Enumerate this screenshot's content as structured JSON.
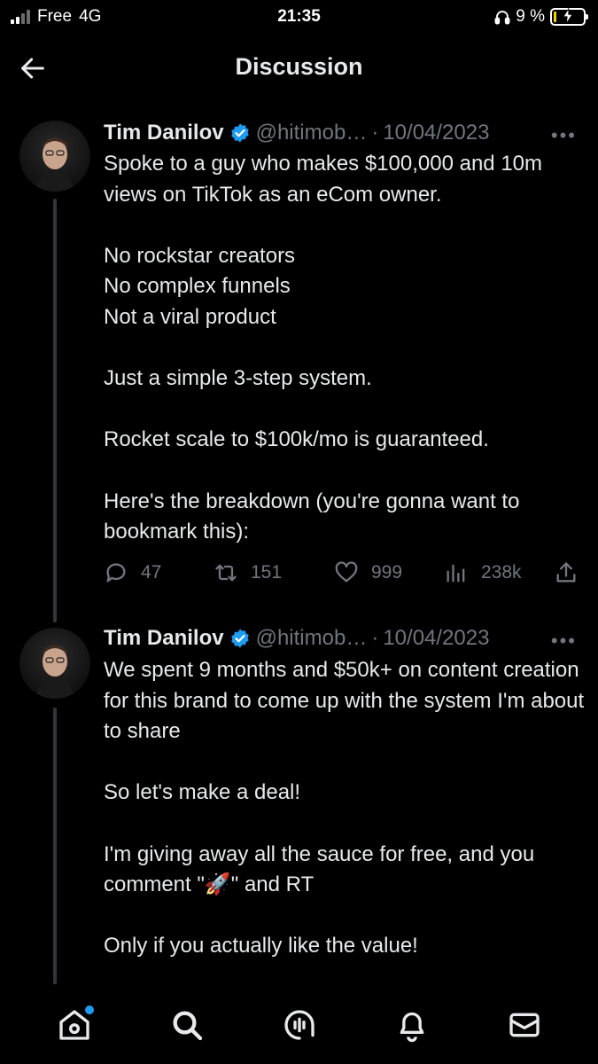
{
  "status_bar": {
    "carrier": "Free",
    "network": "4G",
    "time": "21:35",
    "battery_percent": "9 %",
    "battery_level": 0.09
  },
  "header": {
    "title": "Discussion",
    "back_icon": "arrow-left-icon"
  },
  "tweets": [
    {
      "author_name": "Tim Danilov",
      "handle": "@hitimob…",
      "separator": "·",
      "date": "10/04/2023",
      "more": "•••",
      "text": "Spoke to a guy who makes $100,000 and 10m views on TikTok as an eCom owner.\n\nNo rockstar creators\nNo complex funnels\nNot a viral product\n\nJust a simple 3-step system.\n\nRocket scale to $100k/mo is guaranteed.\n\nHere's the breakdown (you're gonna want to bookmark this):",
      "replies": "47",
      "retweets": "151",
      "likes": "999",
      "views": "238k"
    },
    {
      "author_name": "Tim Danilov",
      "handle": "@hitimob…",
      "separator": "·",
      "date": "10/04/2023",
      "more": "•••",
      "text": "We spent 9 months and $50k+ on content creation for this brand to come up with the system I'm about to share\n\nSo let's make a deal!\n\nI'm giving away all the sauce for free, and you comment \"🚀\" and RT\n\nOnly if you actually like the value!"
    }
  ],
  "bottom_nav": {
    "items": [
      "home-icon",
      "search-icon",
      "spaces-icon",
      "notifications-icon",
      "messages-icon"
    ]
  },
  "colors": {
    "background": "#000000",
    "text": "#e7e9ea",
    "secondary": "#71767b",
    "accent": "#1d9bf0"
  }
}
